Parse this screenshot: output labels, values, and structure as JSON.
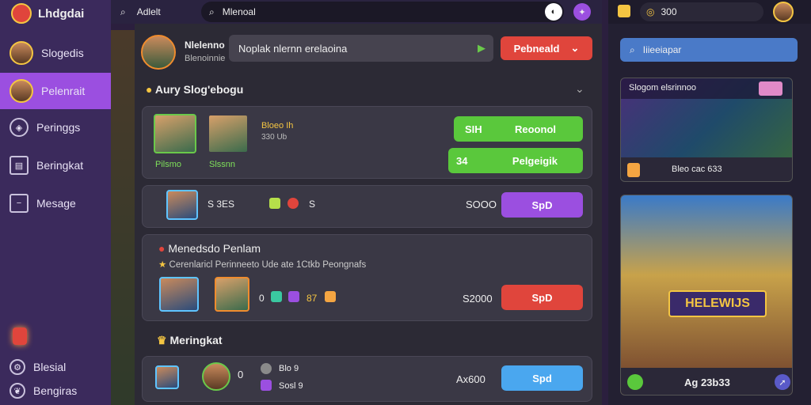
{
  "app": {
    "title": "Lhdgdai"
  },
  "sidebar": {
    "items": [
      {
        "label": "Slogedis",
        "icon": "avatar-icon"
      },
      {
        "label": "Pelenrait",
        "icon": "avatar-icon"
      },
      {
        "label": "Peringgs",
        "icon": "shield-icon"
      },
      {
        "label": "Beringkat",
        "icon": "store-icon"
      },
      {
        "label": "Mesage",
        "icon": "message-icon"
      }
    ],
    "footer": [
      {
        "label": "Blesial"
      },
      {
        "label": "Bengiras"
      }
    ]
  },
  "topbar": {
    "search_label": "Adlelt",
    "search_value": "Mlenoal"
  },
  "rightbar": {
    "currency": "300",
    "search": "Iiieeiapar"
  },
  "profile": {
    "name": "Nlelenno",
    "subtitle": "Blenoinnie"
  },
  "main": {
    "message_input": "Noplak nlernn erelaoina",
    "top_button": "Pebneald",
    "section1": {
      "title": "Aury Slog'ebogu"
    },
    "card1": {
      "name1": "Pilsmo",
      "name2": "Slssnn",
      "stats": "Bloeo Ih",
      "sub": "330 Ub",
      "btn1_left": "SIH",
      "btn1_right": "Reoonol",
      "btn2_left": "34",
      "btn2_right": "Pelgeigik"
    },
    "card2": {
      "stats": "S 3ES",
      "hearts": "S",
      "price": "SOOO",
      "btn": "SpD"
    },
    "card3": {
      "title": "Menedsdo Penlam",
      "desc": "Cerenlaricl Perinneeto Ude ate 1Ctkb Peongnafs",
      "num": "0",
      "count": "87",
      "price": "S2000",
      "btn": "SpD"
    },
    "section2": {
      "title": "Meringkat"
    },
    "card4": {
      "num": "0",
      "stat1": "Blo 9",
      "stat2": "Sosl 9",
      "price": "Ax600",
      "btn": "Spd"
    }
  },
  "promo1": {
    "title": "Slogom elsrinnoo",
    "stats": "Bleo cac 633"
  },
  "promo2": {
    "banner": "HELEWIJS",
    "stats": "Ag 23b33"
  },
  "colors": {
    "accent": "#9b4fe0",
    "green": "#5ac83c",
    "red": "#e0453c",
    "blue": "#4aa7ef"
  }
}
